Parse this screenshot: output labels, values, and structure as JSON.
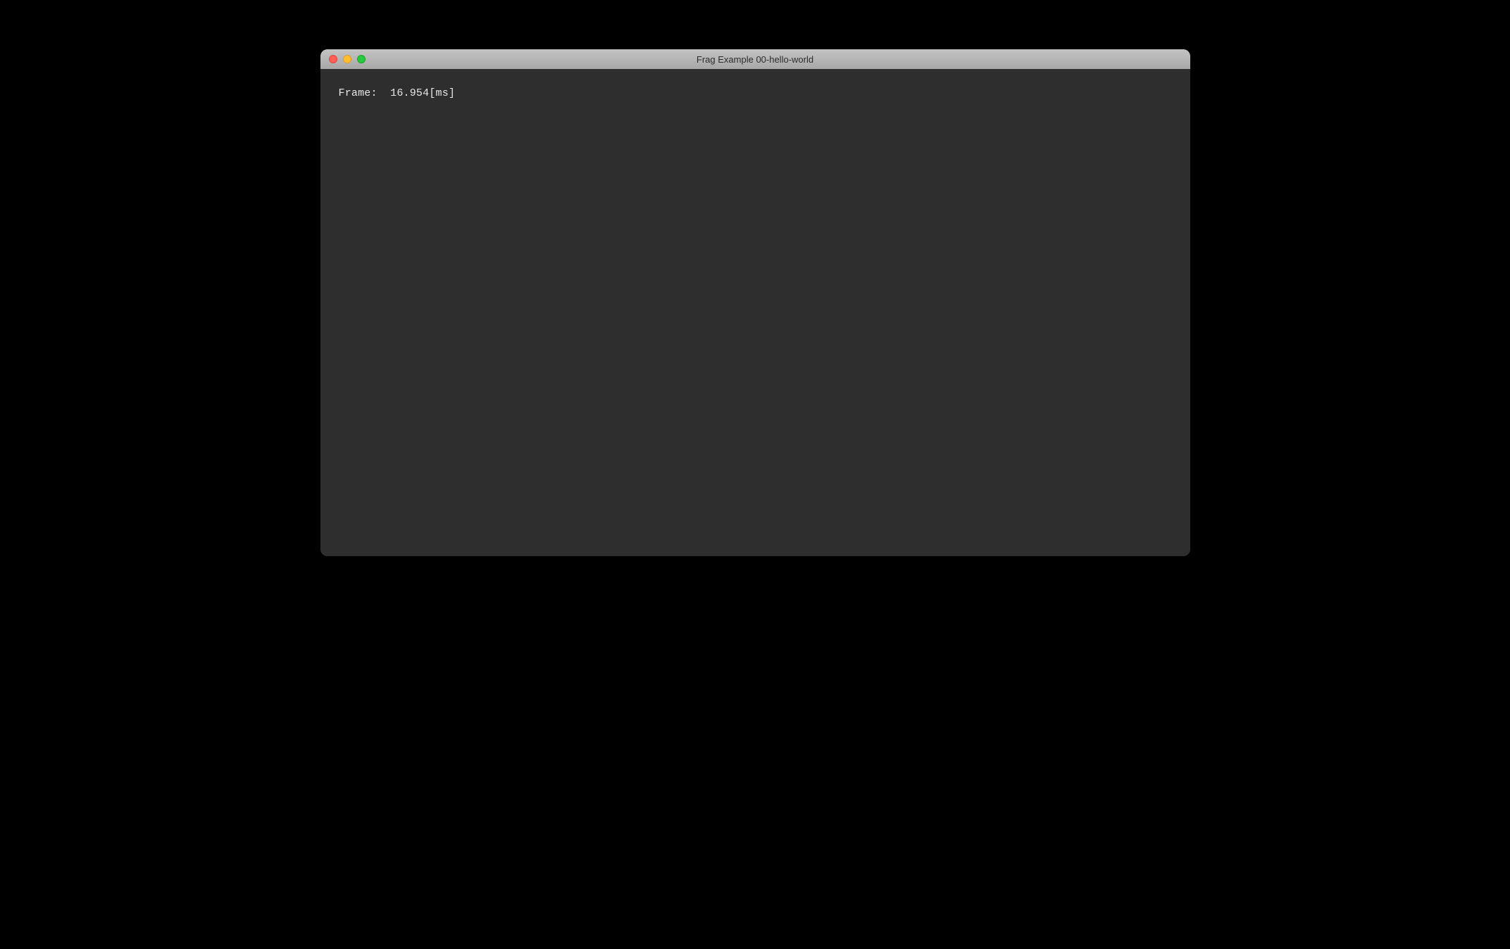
{
  "window": {
    "title": "Frag Example 00-hello-world"
  },
  "content": {
    "frame_line": "Frame:  16.954[ms]"
  },
  "colors": {
    "background": "#000000",
    "window_content": "#2e2e2e",
    "titlebar_top": "#c4c3c3",
    "titlebar_bottom": "#a9a8a8",
    "close": "#ff5f57",
    "minimize": "#febc2e",
    "maximize": "#28c840",
    "text": "#e8e8e8"
  }
}
